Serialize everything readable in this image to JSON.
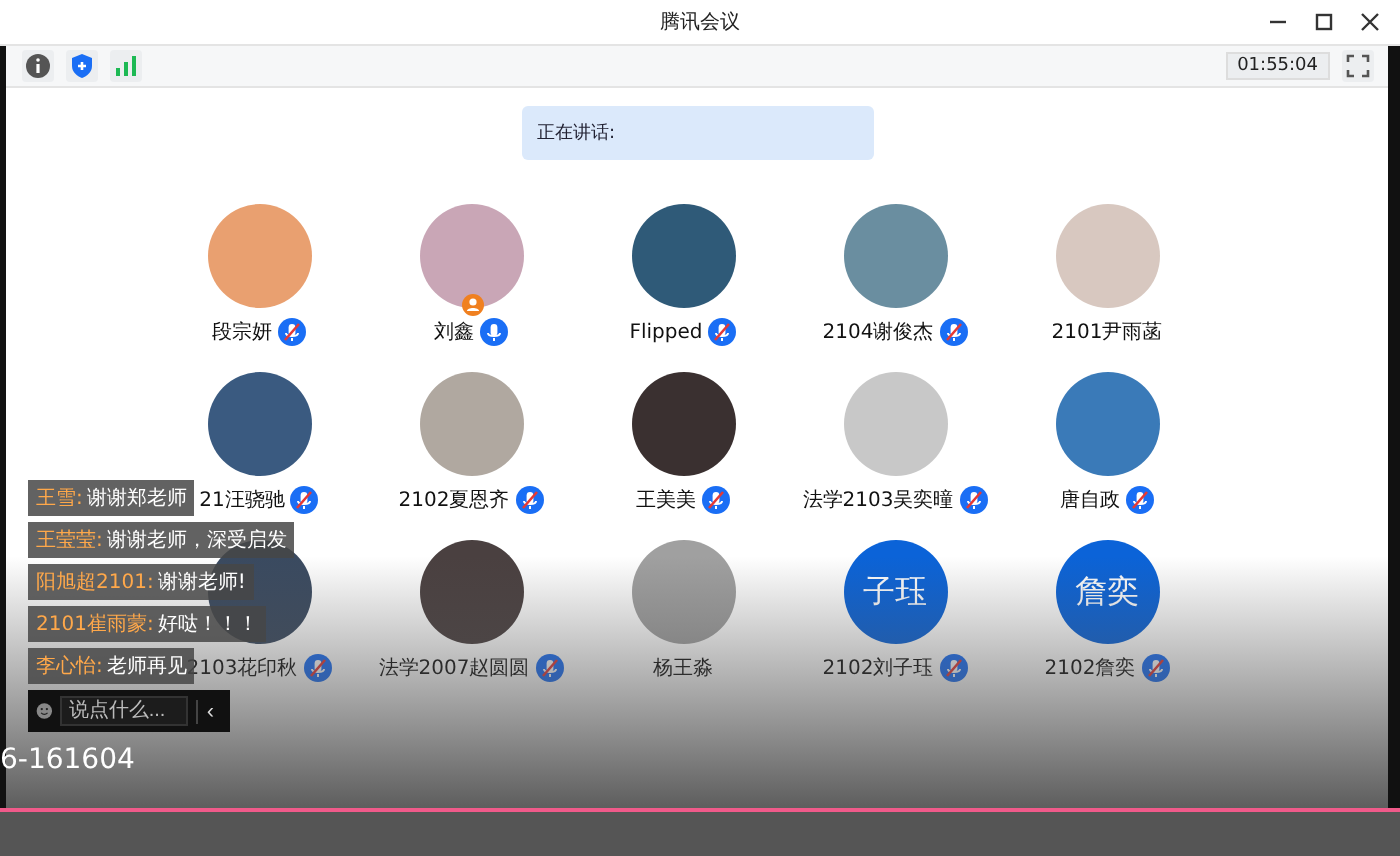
{
  "window": {
    "title": "腾讯会议"
  },
  "toolbar": {
    "timer": "01:55:04"
  },
  "speaking": {
    "label": "正在讲话:"
  },
  "participants": [
    {
      "name": "段宗妍",
      "kind": "photo",
      "muted": true,
      "host": false
    },
    {
      "name": "刘鑫",
      "kind": "photo",
      "muted": false,
      "host": true
    },
    {
      "name": "Flipped",
      "kind": "photo",
      "muted": true,
      "host": false
    },
    {
      "name": "2104谢俊杰",
      "kind": "photo",
      "muted": true,
      "host": false
    },
    {
      "name": "2101尹雨菡",
      "kind": "photo",
      "host": false
    },
    {
      "name": "21汪骁驰",
      "kind": "photo",
      "muted": true,
      "host": false
    },
    {
      "name": "2102夏恩齐",
      "kind": "photo",
      "muted": true,
      "host": false
    },
    {
      "name": "王美美",
      "kind": "photo",
      "muted": true,
      "host": false
    },
    {
      "name": "法学2103吴奕曈",
      "kind": "photo",
      "muted": true,
      "host": false
    },
    {
      "name": "唐自政",
      "kind": "photo",
      "muted": true,
      "host": false
    },
    {
      "name": "2103花印秋",
      "kind": "photo",
      "muted": true,
      "host": false
    },
    {
      "name": "法学2007赵圆圆",
      "kind": "photo",
      "muted": true,
      "host": false
    },
    {
      "name": "杨王淼",
      "kind": "photo",
      "host": false
    },
    {
      "name": "2102刘子珏",
      "kind": "initials",
      "avatar_text": "子珏",
      "muted": true,
      "host": false
    },
    {
      "name": "2102詹奕",
      "kind": "initials",
      "avatar_text": "詹奕",
      "muted": true,
      "host": false
    }
  ],
  "chat": {
    "messages": [
      {
        "sender": "王雪:",
        "text": "谢谢郑老师"
      },
      {
        "sender": "王莹莹:",
        "text": "谢谢老师，深受启发"
      },
      {
        "sender": "阳旭超2101:",
        "text": "谢谢老师!"
      },
      {
        "sender": "2101崔雨蒙:",
        "text": "好哒！！！"
      },
      {
        "sender": "李心怡:",
        "text": "老师再见"
      }
    ],
    "input": {
      "placeholder": "说点什么..."
    },
    "collapse": "‹"
  },
  "video": {
    "id": "6-161604",
    "progress": {
      "level": 1
    }
  }
}
